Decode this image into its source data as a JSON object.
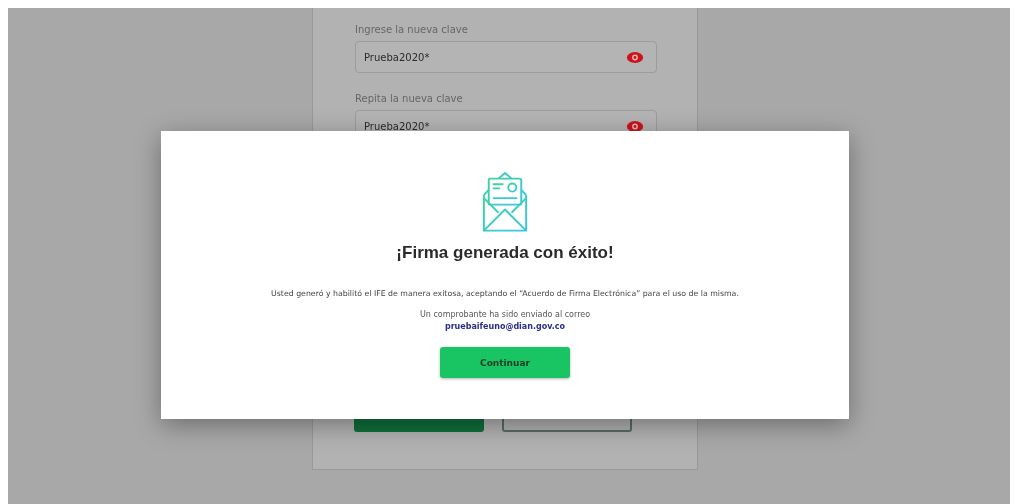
{
  "form": {
    "fields": [
      {
        "label": "Ingrese la nueva clave",
        "value": "Prueba2020*"
      },
      {
        "label": "Repita la nueva clave",
        "value": "Prueba2020*"
      }
    ]
  },
  "modal": {
    "title": "¡Firma generada con éxito!",
    "message": "Usted generó y habilitó el IFE de manera exitosa, aceptando el “Acuerdo de Firma Electrónica” para el uso de la misma.",
    "note": "Un comprobante ha sido enviado al correo",
    "email": "pruebaifeuno@dian.gov.co",
    "button": "Continuar"
  }
}
